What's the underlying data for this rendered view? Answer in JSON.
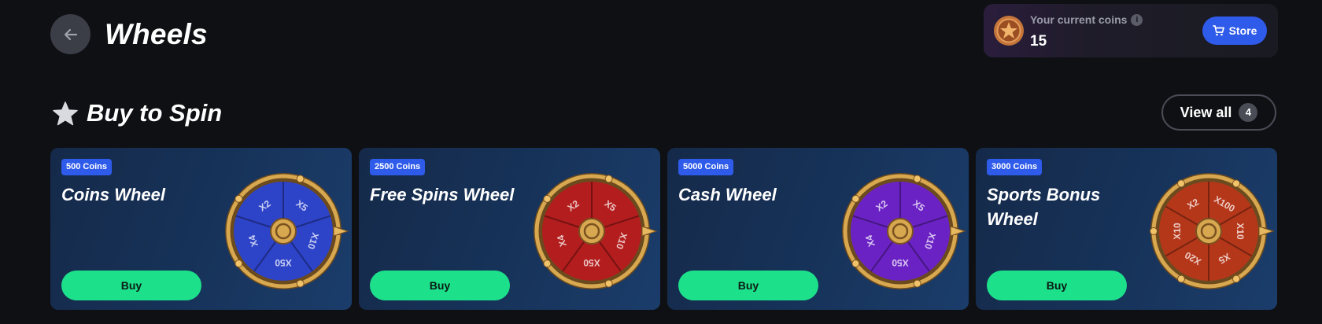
{
  "header": {
    "title": "Wheels",
    "back_icon": "arrow-left-icon"
  },
  "coins": {
    "label": "Your current coins",
    "info_glyph": "i",
    "value": "15",
    "store_label": "Store",
    "store_icon": "cart-icon"
  },
  "section": {
    "title": "Buy to Spin",
    "icon": "star-icon",
    "view_all_label": "View all",
    "view_all_count": "4"
  },
  "cards": [
    {
      "price": "500 Coins",
      "title": "Coins Wheel",
      "buy_label": "Buy",
      "wheel_color": "#2d43c8",
      "wheel_labels": [
        "X5",
        "X10",
        "X50",
        "X4",
        "X2"
      ]
    },
    {
      "price": "2500 Coins",
      "title": "Free Spins Wheel",
      "buy_label": "Buy",
      "wheel_color": "#b31d1d",
      "wheel_labels": [
        "X5",
        "X10",
        "X50",
        "X4",
        "X2"
      ]
    },
    {
      "price": "5000 Coins",
      "title": "Cash Wheel",
      "buy_label": "Buy",
      "wheel_color": "#6a22c4",
      "wheel_labels": [
        "X5",
        "X10",
        "X50",
        "X4",
        "X2"
      ]
    },
    {
      "price": "3000 Coins",
      "title": "Sports Bonus Wheel",
      "buy_label": "Buy",
      "wheel_color": "#b5371a",
      "wheel_labels": [
        "X100",
        "X10",
        "X5",
        "X20",
        "X10",
        "X2"
      ]
    }
  ],
  "colors": {
    "background": "#0f1014",
    "accent_blue": "#2f5bea",
    "buy_green": "#1de08b"
  }
}
